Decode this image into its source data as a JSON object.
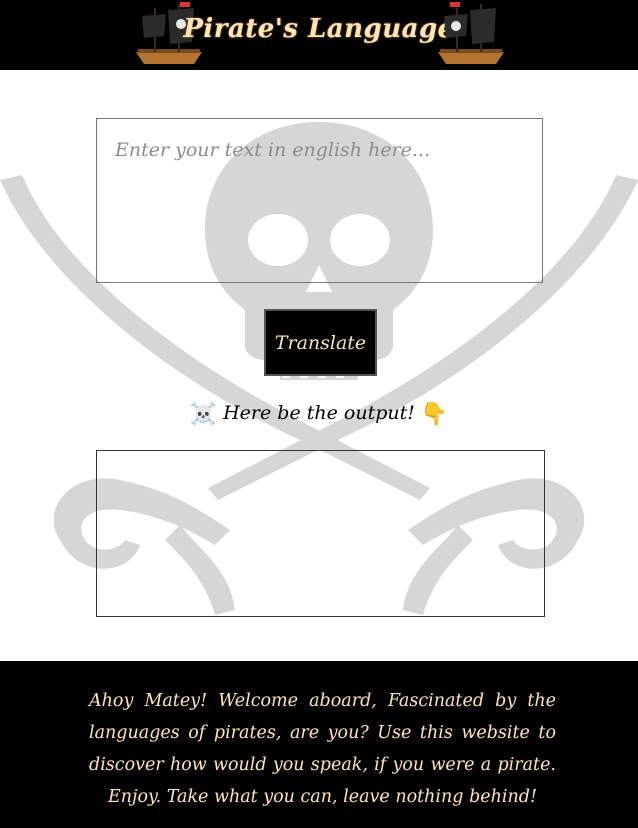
{
  "header": {
    "title": "Pirate's Language"
  },
  "input": {
    "placeholder": "Enter your text in english here...",
    "value": ""
  },
  "translate_button": {
    "label": "Translate"
  },
  "output": {
    "label_emoji_left": "☠️",
    "label_text": "Here be the output!",
    "label_emoji_right": "👇",
    "value": ""
  },
  "footer": {
    "text": "Ahoy Matey! Welcome aboard, Fascinated by the languages of pirates, are you? Use this website to discover how would you speak, if you were a pirate. Enjoy. Take what you can, leave nothing behind!"
  },
  "colors": {
    "header_bg": "#000000",
    "accent_text": "#ffe5b4",
    "background_art": "#d6d6d6",
    "page_bg": "#ffffff"
  },
  "icons": {
    "header_left": "pirate-ship-icon",
    "header_right": "pirate-ship-icon",
    "background": "jolly-roger-icon"
  }
}
